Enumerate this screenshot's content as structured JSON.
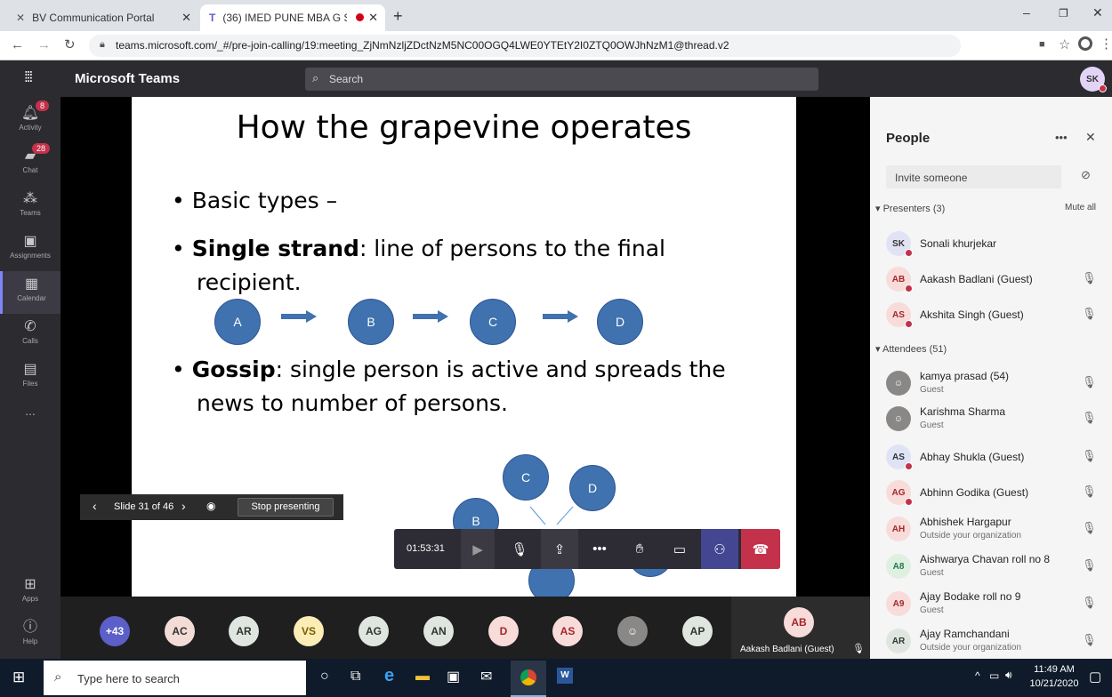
{
  "browser": {
    "tabs": [
      {
        "title": "BV Communication Portal"
      },
      {
        "title": "(36) IMED PUNE MBA G SEM"
      }
    ],
    "url": "teams.microsoft.com/_#/pre-join-calling/19:meeting_ZjNmNzljZDctNzM5NC00OGQ4LWE0YTEtY2I0ZTQ0OWJhNzM1@thread.v2"
  },
  "teams": {
    "brand": "Microsoft Teams",
    "search_placeholder": "Search",
    "user_initials": "SK",
    "rail": [
      {
        "label": "Activity",
        "badge": "8"
      },
      {
        "label": "Chat",
        "badge": "28"
      },
      {
        "label": "Teams"
      },
      {
        "label": "Assignments"
      },
      {
        "label": "Calendar"
      },
      {
        "label": "Calls"
      },
      {
        "label": "Files"
      },
      {
        "label": "..."
      },
      {
        "label": "Apps"
      },
      {
        "label": "Help"
      }
    ]
  },
  "slide": {
    "title": "How the grapevine operates",
    "bullet1": "Basic types –",
    "bullet2_bold": "Single strand",
    "bullet2_rest": ": line of persons to the final recipient.",
    "bullet3_bold": "Gossip",
    "bullet3_rest": ": single person is active and spreads the news to number of persons.",
    "chain_nodes": [
      "A",
      "B",
      "C",
      "D"
    ],
    "gossip_nodes": [
      "C",
      "D",
      "B"
    ]
  },
  "presenter_bar": {
    "slide_counter": "Slide 31 of 46",
    "stop_label": "Stop presenting"
  },
  "call_controls": {
    "timer": "01:53:31"
  },
  "people": {
    "title": "People",
    "invite_placeholder": "Invite someone",
    "presenters_header": "Presenters (3)",
    "mute_all": "Mute all",
    "attendees_header": "Attendees (51)",
    "presenters": [
      {
        "initials": "SK",
        "name": "Sonali khurjekar"
      },
      {
        "initials": "AB",
        "name": "Aakash Badlani (Guest)"
      },
      {
        "initials": "AS",
        "name": "Akshita Singh (Guest)"
      }
    ],
    "attendees": [
      {
        "initials": "",
        "name": "kamya prasad (54)",
        "sub": "Guest"
      },
      {
        "initials": "",
        "name": "Karishma Sharma",
        "sub": "Guest"
      },
      {
        "initials": "AS",
        "name": "Abhay Shukla (Guest)",
        "sub": ""
      },
      {
        "initials": "AG",
        "name": "Abhinn Godika (Guest)",
        "sub": ""
      },
      {
        "initials": "AH",
        "name": "Abhishek Hargapur",
        "sub": "Outside your organization"
      },
      {
        "initials": "A8",
        "name": "Aishwarya Chavan roll no 8",
        "sub": "Guest"
      },
      {
        "initials": "A9",
        "name": "Ajay Bodake roll no 9",
        "sub": "Guest"
      },
      {
        "initials": "AR",
        "name": "Ajay Ramchandani",
        "sub": "Outside your organization"
      }
    ]
  },
  "gallery": {
    "overflow": "+43",
    "avatars": [
      "AC",
      "AR",
      "VS",
      "AG",
      "AN",
      "D",
      "AS",
      "",
      "AP"
    ],
    "active_initials": "AB",
    "active_name": "Aakash Badlani (Guest)"
  },
  "taskbar": {
    "search_placeholder": "Type here to search",
    "time": "11:49 AM",
    "date": "10/21/2020"
  }
}
